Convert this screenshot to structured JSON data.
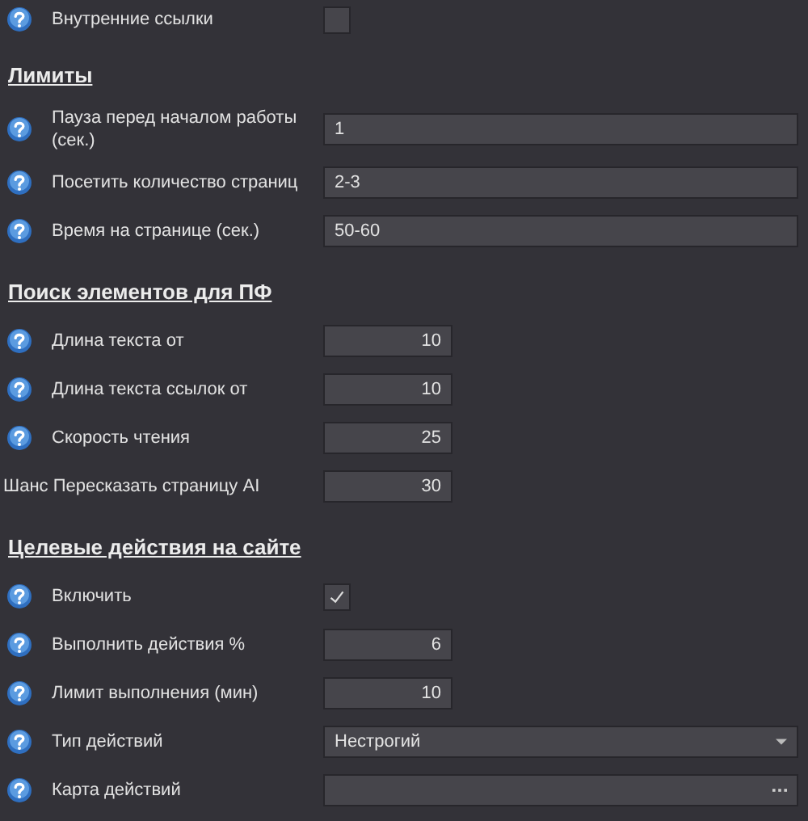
{
  "sections": [
    {
      "rows": [
        {
          "help": true,
          "label": "Внутренние ссылки",
          "kind": "checkbox",
          "checked": false
        }
      ]
    },
    {
      "title": "Лимиты",
      "rows": [
        {
          "help": true,
          "label": "Пауза перед началом работы (сек.)",
          "kind": "text",
          "value": "1"
        },
        {
          "help": true,
          "label": "Посетить количество страниц",
          "kind": "text",
          "value": "2-3"
        },
        {
          "help": true,
          "label": "Время на странице (сек.)",
          "kind": "text",
          "value": "50-60"
        }
      ]
    },
    {
      "title": "Поиск элементов для ПФ",
      "rows": [
        {
          "help": true,
          "label": "Длина текста от",
          "kind": "number",
          "value": "10"
        },
        {
          "help": true,
          "label": "Длина текста ссылок от",
          "kind": "number",
          "value": "10"
        },
        {
          "help": true,
          "label": "Скорость чтения",
          "kind": "number",
          "value": "25"
        },
        {
          "help": false,
          "label": "Шанс Пересказать страницу AI",
          "kind": "number",
          "value": "30"
        }
      ]
    },
    {
      "title": "Целевые действия на сайте",
      "rows": [
        {
          "help": true,
          "label": "Включить",
          "kind": "checkbox",
          "checked": true
        },
        {
          "help": true,
          "label": "Выполнить действия %",
          "kind": "number",
          "value": "6"
        },
        {
          "help": true,
          "label": "Лимит выполнения (мин)",
          "kind": "number",
          "value": "10"
        },
        {
          "help": true,
          "label": "Тип действий",
          "kind": "select",
          "value": "Нестрогий"
        },
        {
          "help": true,
          "label": "Карта действий",
          "kind": "picker"
        }
      ]
    }
  ]
}
